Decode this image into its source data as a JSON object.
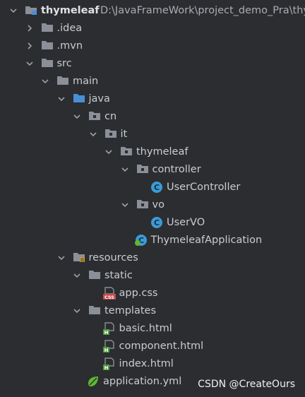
{
  "root": {
    "name": "thymeleaf",
    "path": "D:\\JavaFrameWork\\project_demo_Pra\\thy"
  },
  "nodes": [
    {
      "label": ".idea",
      "icon": "folder",
      "chevron": "right",
      "depth": 1
    },
    {
      "label": ".mvn",
      "icon": "folder",
      "chevron": "right",
      "depth": 1
    },
    {
      "label": "src",
      "icon": "folder",
      "chevron": "down",
      "depth": 1
    },
    {
      "label": "main",
      "icon": "folder",
      "chevron": "down",
      "depth": 2
    },
    {
      "label": "java",
      "icon": "folder-blue",
      "chevron": "down",
      "depth": 3
    },
    {
      "label": "cn",
      "icon": "package",
      "chevron": "down",
      "depth": 4
    },
    {
      "label": "it",
      "icon": "package",
      "chevron": "down",
      "depth": 5
    },
    {
      "label": "thymeleaf",
      "icon": "package",
      "chevron": "down",
      "depth": 6
    },
    {
      "label": "controller",
      "icon": "package",
      "chevron": "down",
      "depth": 7
    },
    {
      "label": "UserController",
      "icon": "class",
      "chevron": "none",
      "depth": 8
    },
    {
      "label": "vo",
      "icon": "package",
      "chevron": "down",
      "depth": 7
    },
    {
      "label": "UserVO",
      "icon": "class",
      "chevron": "none",
      "depth": 8
    },
    {
      "label": "ThymeleafApplication",
      "icon": "spring-class",
      "chevron": "none",
      "depth": 7
    },
    {
      "label": "resources",
      "icon": "resources",
      "chevron": "down",
      "depth": 3
    },
    {
      "label": "static",
      "icon": "folder",
      "chevron": "down",
      "depth": 4
    },
    {
      "label": "app.css",
      "icon": "css-file",
      "chevron": "none",
      "depth": 5
    },
    {
      "label": "templates",
      "icon": "folder",
      "chevron": "down",
      "depth": 4
    },
    {
      "label": "basic.html",
      "icon": "html-file",
      "chevron": "none",
      "depth": 5
    },
    {
      "label": "component.html",
      "icon": "html-file",
      "chevron": "none",
      "depth": 5
    },
    {
      "label": "index.html",
      "icon": "html-file",
      "chevron": "none",
      "depth": 5
    },
    {
      "label": "application.yml",
      "icon": "yml-file",
      "chevron": "none",
      "depth": 4
    }
  ],
  "icon_colors": {
    "folder": "#8a8f98",
    "folder_blue": "#4a8fd6",
    "class": "#3a9bd9",
    "spring": "#5fb832",
    "css_badge": "#c24a4a",
    "html_badge": "#4f9a3e"
  },
  "watermark": "CSDN @CreateOurs"
}
